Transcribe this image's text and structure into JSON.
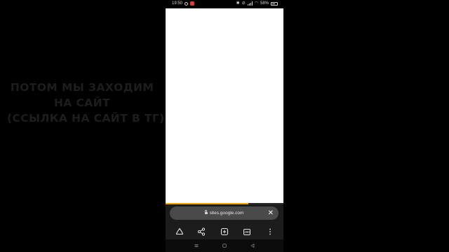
{
  "caption": {
    "line1": "ПОТОМ МЫ ЗАХОДИМ",
    "line2": "НА САЙТ",
    "line3": "(ССЫЛКА НА САЙТ В ТГ)"
  },
  "status_bar": {
    "time": "19:50",
    "battery": "58%"
  },
  "browser": {
    "url": "sites.google.com",
    "load_progress": 0.7,
    "tab_count": "290"
  },
  "colors": {
    "progress": "#f0a500",
    "toolbar": "#1c1c1c",
    "urlbar": "#4a4a4a"
  }
}
